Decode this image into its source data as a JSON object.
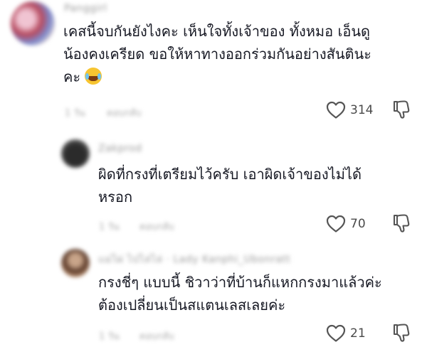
{
  "comments": [
    {
      "username": "Panggirl",
      "text_lines": [
        "เคสนี้จบกันยังไงคะ เห็นใจทั้งเจ้าของ ทั้งหมอ เอ็นดู",
        "น้องคงเครียด ขอให้หาทางออกร่วมกันอย่างสันตินะ",
        "คะ"
      ],
      "emoji": "😂",
      "time": "1 วัน",
      "reply_label": "ตอบกลับ",
      "likes": "314"
    },
    {
      "username": "Zakprod",
      "text_lines": [
        "ผิดที่กรงที่เตรียมไว้ครับ เอาผิดเจ้าของไม่ได้",
        "หรอก"
      ],
      "time": "1 วัน",
      "reply_label": "ตอบกลับ",
      "likes": "70"
    },
    {
      "username": "แม่ไผ่ ไปไล่ไล่ · Lady Kanphi_Ubonratt",
      "text_lines": [
        "กรงชี่ๆ แบบนี้ ชิวาว่าที่บ้านก็แหกกรงมาแล้วค่ะ",
        "ต้องเปลี่ยนเป็นสแตนเลสเลยค่ะ"
      ],
      "time": "1 วัน",
      "reply_label": "ตอบกลับ",
      "likes": "21"
    }
  ],
  "colors": {
    "text": "#161823",
    "muted": "#9a9a9a",
    "icon": "#555555"
  },
  "icons": {
    "like": "heart-outline-icon",
    "dislike": "thumb-down-outline-icon"
  }
}
